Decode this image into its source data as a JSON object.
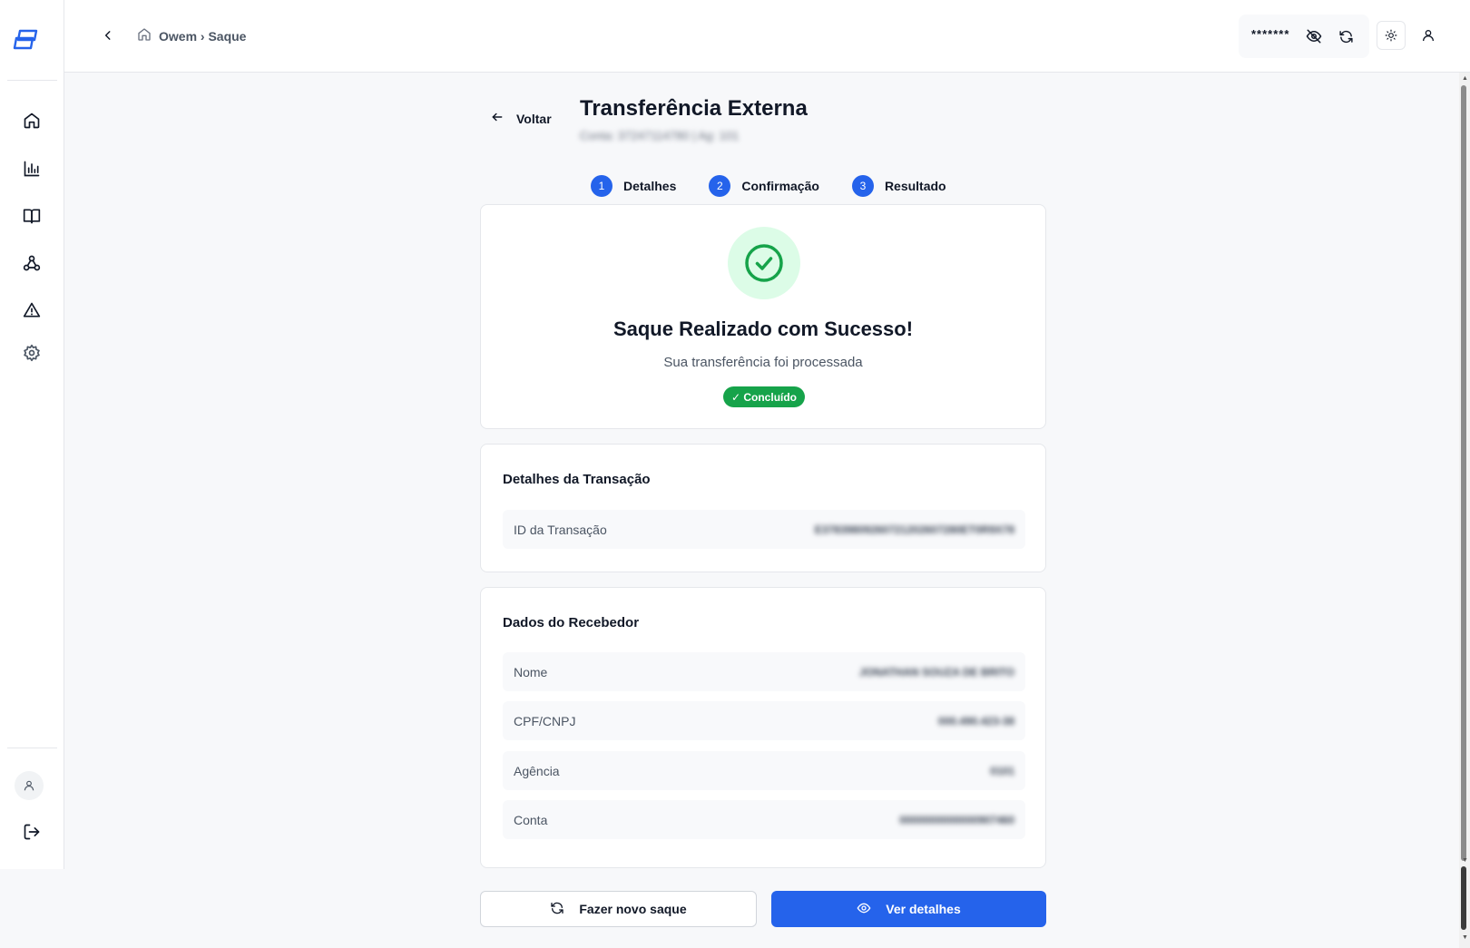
{
  "header": {
    "breadcrumb": "Owem › Saque",
    "balance_mask": "*******"
  },
  "page": {
    "back_label": "Voltar",
    "title": "Transferência Externa",
    "subtitle": "Conta: 37247114780 | Ag: 101"
  },
  "stepper": {
    "steps": [
      {
        "num": "1",
        "label": "Detalhes"
      },
      {
        "num": "2",
        "label": "Confirmação"
      },
      {
        "num": "3",
        "label": "Resultado"
      }
    ]
  },
  "result": {
    "title": "Saque Realizado com Sucesso!",
    "subtitle": "Sua transferência foi processada",
    "badge": "✓ Concluído"
  },
  "transaction": {
    "title": "Detalhes da Transação",
    "rows": [
      {
        "label": "ID da Transação",
        "value": "E37839809260721202607280ET0R9X78"
      }
    ]
  },
  "receiver": {
    "title": "Dados do Recebedor",
    "rows": [
      {
        "label": "Nome",
        "value": "JONATHAN SOUZA DE BRITO"
      },
      {
        "label": "CPF/CNPJ",
        "value": "000.490.423-38"
      },
      {
        "label": "Agência",
        "value": "0101"
      },
      {
        "label": "Conta",
        "value": "0000000000000907460"
      }
    ]
  },
  "actions": {
    "new_withdrawal": "Fazer novo saque",
    "view_details": "Ver detalhes"
  },
  "colors": {
    "primary": "#2563eb",
    "success": "#16a34a",
    "success_bg": "#dcfce7"
  }
}
